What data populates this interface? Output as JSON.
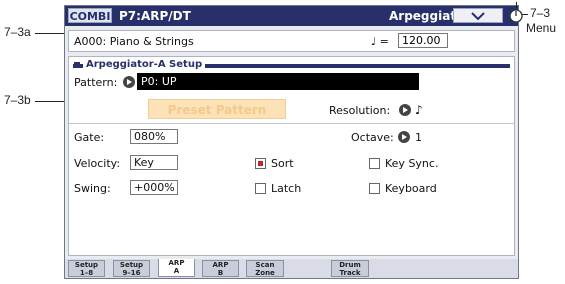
{
  "callouts": {
    "c73a": "7–3a",
    "c73b": "7–3b",
    "c73": "7–3",
    "menu": "Menu"
  },
  "titlebar": {
    "mode": "COMBI",
    "page": "P7:ARP/DT",
    "tab_label": "Arpeggiator A"
  },
  "program": {
    "name": "A000: Piano & Strings",
    "tempo_label": "♩ =",
    "tempo_value": "120.00"
  },
  "section": {
    "title": "Arpeggiator-A Setup"
  },
  "pattern": {
    "label": "Pattern:",
    "value": "P0: UP",
    "preset_button": "Preset Pattern",
    "resolution_label": "Resolution:",
    "resolution_value": "♪"
  },
  "fields": {
    "gate_label": "Gate:",
    "gate_value": "080%",
    "octave_label": "Octave:",
    "octave_value": "1",
    "velocity_label": "Velocity:",
    "velocity_value": "Key",
    "swing_label": "Swing:",
    "swing_value": "+000%"
  },
  "checkboxes": {
    "sort": "Sort",
    "sort_checked": true,
    "key_sync": "Key Sync.",
    "key_sync_checked": false,
    "latch": "Latch",
    "latch_checked": false,
    "keyboard": "Keyboard",
    "keyboard_checked": false
  },
  "tabs": [
    {
      "line1": "Setup",
      "line2": "1–8",
      "active": false
    },
    {
      "line1": "Setup",
      "line2": "9–16",
      "active": false
    },
    {
      "line1": "ARP",
      "line2": "A",
      "active": true
    },
    {
      "line1": "ARP",
      "line2": "B",
      "active": false
    },
    {
      "line1": "Scan",
      "line2": "Zone",
      "active": false
    },
    {
      "line1": "Drum",
      "line2": "Track",
      "active": false
    }
  ]
}
